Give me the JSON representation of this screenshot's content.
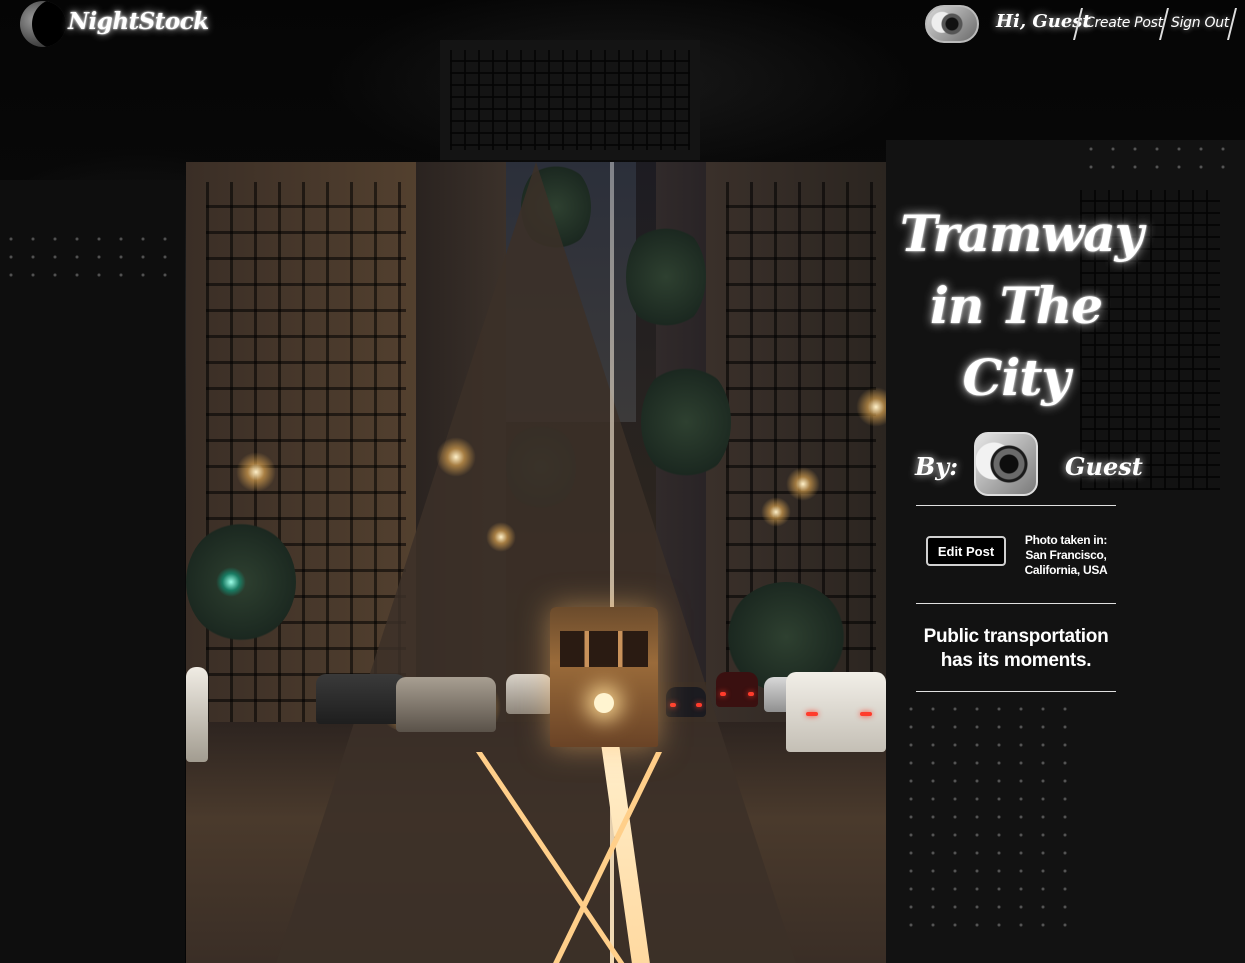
{
  "header": {
    "brand": "NightStock",
    "greeting": "Hi, Guest",
    "nav": {
      "create_post": "Create Post",
      "sign_out": "Sign Out"
    }
  },
  "post": {
    "title_lines": [
      "Tramway",
      "in The",
      "City"
    ],
    "by_label": "By:",
    "author": "Guest",
    "edit_button": "Edit Post",
    "location_lines": [
      "Photo taken in:",
      "San Francisco,",
      "California, USA"
    ],
    "description": "Public transportation has its moments."
  },
  "icons": {
    "logo": "moon-icon",
    "header_avatar": "camera-lens-avatar",
    "author_avatar": "camera-lens-avatar"
  },
  "colors": {
    "background": "#000000",
    "text": "#ffffff",
    "button_border": "#d0d0d0"
  }
}
